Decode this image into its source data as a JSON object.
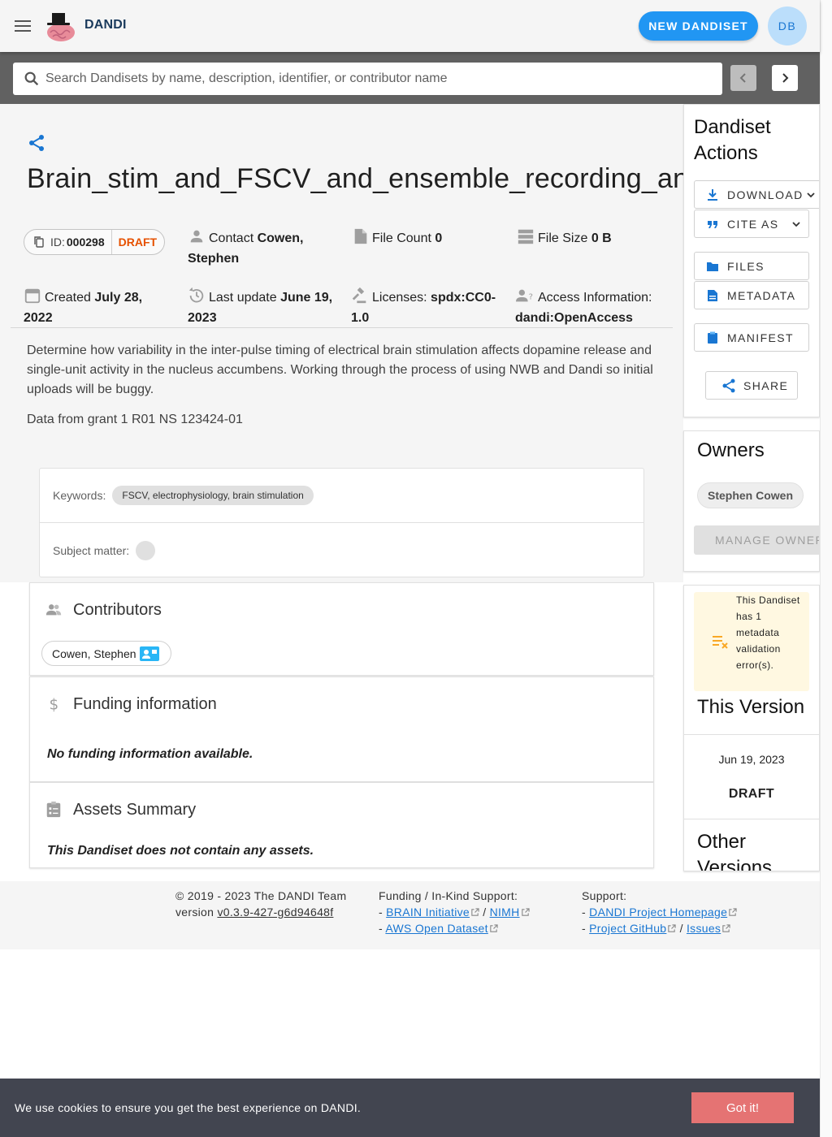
{
  "header": {
    "brand": "DANDI",
    "new_dandiset_label": "NEW DANDISET",
    "avatar_initials": "DB"
  },
  "search": {
    "placeholder": "Search Dandisets by name, description, identifier, or contributor name"
  },
  "dandiset": {
    "title": "Brain_stim_and_FSCV_and_ensemble_recording_anesthetized",
    "id_label": "ID:",
    "id_value": "000298",
    "status": "DRAFT",
    "contact_label": "Contact",
    "contact_value": "Cowen, Stephen",
    "file_count_label": "File Count",
    "file_count_value": "0",
    "file_size_label": "File Size",
    "file_size_value": "0 B",
    "created_label": "Created",
    "created_value": "July 28, 2022",
    "updated_label": "Last update",
    "updated_value": "June 19, 2023",
    "licenses_label": "Licenses:",
    "licenses_value": "spdx:CC0-1.0",
    "access_label": "Access Information:",
    "access_value": "dandi:OpenAccess",
    "description": "Determine how variability in the inter-pulse timing of electrical brain stimulation affects dopamine release and single-unit activity in the nucleus accumbens. Working through the process of using NWB and Dandi so initial uploads will be buggy.",
    "grant": "Data from grant 1 R01 NS 123424-01",
    "keywords_label": "Keywords:",
    "keywords_value": "FSCV, electrophysiology, brain stimulation",
    "subject_matter_label": "Subject matter:"
  },
  "contributors": {
    "title": "Contributors",
    "items": [
      "Cowen, Stephen"
    ]
  },
  "funding": {
    "title": "Funding information",
    "empty": "No funding information available."
  },
  "assets": {
    "title": "Assets Summary",
    "empty": "This Dandiset does not contain any assets."
  },
  "actions": {
    "title": "Dandiset Actions",
    "download": "DOWNLOAD",
    "cite_as": "CITE AS",
    "files": "FILES",
    "metadata": "METADATA",
    "manifest": "MANIFEST",
    "share": "SHARE"
  },
  "owners": {
    "title": "Owners",
    "items": [
      "Stephen Cowen"
    ],
    "manage_label": "MANAGE OWNERS"
  },
  "version": {
    "warning": "This Dandiset has 1 metadata validation error(s).",
    "title": "This Version",
    "date": "Jun 19, 2023",
    "status": "DRAFT",
    "other_title": "Other Versions"
  },
  "footer": {
    "copyright": "© 2019 - 2023 The DANDI Team",
    "version_prefix": "version",
    "version_link": "v0.3.9-427-g6d94648f",
    "funding_title": "Funding / In-Kind Support:",
    "brain_initiative": "BRAIN Initiative",
    "nimh": "NIMH",
    "aws": "AWS Open Dataset",
    "support_title": "Support:",
    "homepage": "DANDI Project Homepage",
    "github": "Project GitHub",
    "issues": "Issues"
  },
  "cookie": {
    "text": "We use cookies to ensure you get the best experience on DANDI.",
    "button": "Got it!"
  },
  "colors": {
    "primary": "#2196f3",
    "draft": "#e65100",
    "warning_bg": "#fff8e1",
    "warning_icon": "#f9a825",
    "cookie_bg": "#424550",
    "cookie_button": "#e57373"
  },
  "icons": [
    "menu-icon",
    "brain-logo",
    "search-icon",
    "chevron-left-icon",
    "chevron-right-icon",
    "share-icon",
    "copy-icon",
    "person-icon",
    "file-icon",
    "storage-icon",
    "calendar-icon",
    "history-icon",
    "gavel-icon",
    "person-question-icon",
    "group-icon",
    "dollar-icon",
    "assignment-icon",
    "contact-mail-icon",
    "download-icon",
    "quote-icon",
    "folder-icon",
    "description-icon",
    "clipboard-icon",
    "person-add-icon",
    "playlist-remove-icon",
    "external-link-icon"
  ]
}
